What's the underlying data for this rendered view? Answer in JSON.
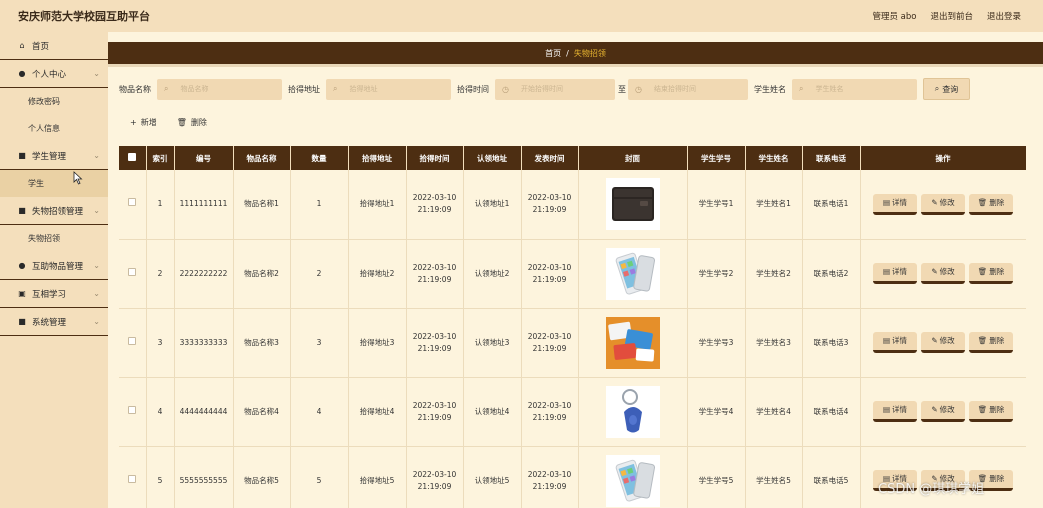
{
  "header": {
    "app_title": "安庆师范大学校园互助平台",
    "admin_label": "管理员 abo",
    "goto_front": "退出到前台",
    "logout": "退出登录"
  },
  "sidebar": {
    "home": "首页",
    "personal_center": "个人中心",
    "change_password": "修改密码",
    "personal_info": "个人信息",
    "student_mgmt": "学生管理",
    "student": "学生",
    "lost_found_mgmt": "失物招领管理",
    "lost_found": "失物招领",
    "mutual_items_mgmt": "互助物品管理",
    "mutual_learning": "互相学习",
    "system_mgmt": "系统管理"
  },
  "breadcrumb": {
    "home": "首页",
    "sep": "/",
    "current": "失物招领"
  },
  "search": {
    "item_name_label": "物品名称",
    "item_name_placeholder": "物品名称",
    "pickup_addr_label": "拾得地址",
    "pickup_addr_placeholder": "拾得地址",
    "pickup_time_label": "拾得时间",
    "start_time_placeholder": "开始拾得时间",
    "to_label": "至",
    "end_time_placeholder": "结束拾得时间",
    "student_name_label": "学生姓名",
    "student_name_placeholder": "学生姓名",
    "search_button": "查询"
  },
  "toolbar": {
    "add": "新增",
    "delete": "删除"
  },
  "table": {
    "headers": {
      "index": "索引",
      "number": "编号",
      "item_name": "物品名称",
      "quantity": "数量",
      "pickup_addr": "拾得地址",
      "pickup_time": "拾得时间",
      "claim_addr": "认领地址",
      "post_time": "发表时间",
      "cover": "封面",
      "student_id": "学生学号",
      "student_name": "学生姓名",
      "phone": "联系电话",
      "actions": "操作"
    },
    "rows": [
      {
        "index": "1",
        "number": "1111111111",
        "item_name": "物品名称1",
        "quantity": "1",
        "pickup_addr": "拾得地址1",
        "pickup_date": "2022-03-10",
        "pickup_clock": "21:19:09",
        "claim_addr": "认领地址1",
        "post_date": "2022-03-10",
        "post_clock": "21:19:09",
        "cover": "wallet",
        "student_id": "学生学号1",
        "student_name": "学生姓名1",
        "phone": "联系电话1",
        "detail": "详情",
        "edit": "修改",
        "del": "删除"
      },
      {
        "index": "2",
        "number": "2222222222",
        "item_name": "物品名称2",
        "quantity": "2",
        "pickup_addr": "拾得地址2",
        "pickup_date": "2022-03-10",
        "pickup_clock": "21:19:09",
        "claim_addr": "认领地址2",
        "post_date": "2022-03-10",
        "post_clock": "21:19:09",
        "cover": "phone",
        "student_id": "学生学号2",
        "student_name": "学生姓名2",
        "phone": "联系电话2",
        "detail": "详情",
        "edit": "修改",
        "del": "删除"
      },
      {
        "index": "3",
        "number": "3333333333",
        "item_name": "物品名称3",
        "quantity": "3",
        "pickup_addr": "拾得地址3",
        "pickup_date": "2022-03-10",
        "pickup_clock": "21:19:09",
        "claim_addr": "认领地址3",
        "post_date": "2022-03-10",
        "post_clock": "21:19:09",
        "cover": "cards",
        "student_id": "学生学号3",
        "student_name": "学生姓名3",
        "phone": "联系电话3",
        "detail": "详情",
        "edit": "修改",
        "del": "删除"
      },
      {
        "index": "4",
        "number": "4444444444",
        "item_name": "物品名称4",
        "quantity": "4",
        "pickup_addr": "拾得地址4",
        "pickup_date": "2022-03-10",
        "pickup_clock": "21:19:09",
        "claim_addr": "认领地址4",
        "post_date": "2022-03-10",
        "post_clock": "21:19:09",
        "cover": "keyfob",
        "student_id": "学生学号4",
        "student_name": "学生姓名4",
        "phone": "联系电话4",
        "detail": "详情",
        "edit": "修改",
        "del": "删除"
      },
      {
        "index": "5",
        "number": "5555555555",
        "item_name": "物品名称5",
        "quantity": "5",
        "pickup_addr": "拾得地址5",
        "pickup_date": "2022-03-10",
        "pickup_clock": "21:19:09",
        "claim_addr": "认领地址5",
        "post_date": "2022-03-10",
        "post_clock": "21:19:09",
        "cover": "phone",
        "student_id": "学生学号5",
        "student_name": "学生姓名5",
        "phone": "联系电话5",
        "detail": "详情",
        "edit": "修改",
        "del": "删除"
      }
    ]
  },
  "watermark": "CSDN @琪琪学姐",
  "colors": {
    "page_bg": "#f4dfbc",
    "panel_bg": "#fdf4dd",
    "dark_brown": "#4d2e12",
    "input_bg": "#f1d9b3",
    "accent_gold": "#e8b530"
  }
}
